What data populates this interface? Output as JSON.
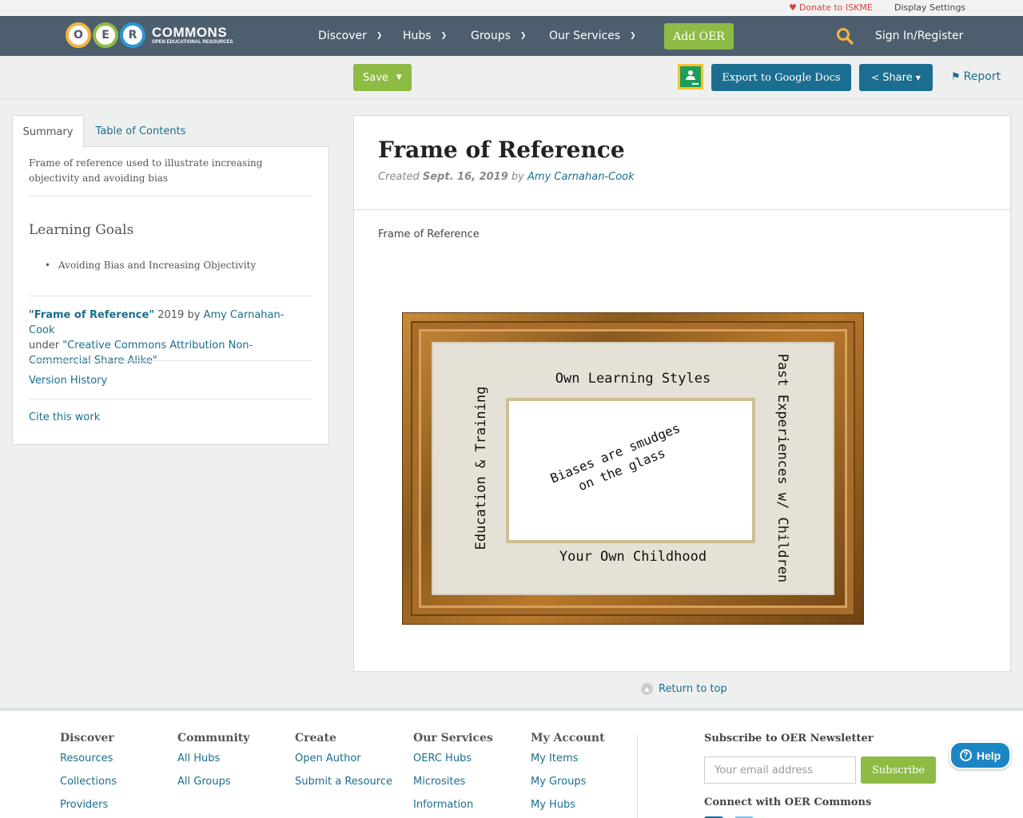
{
  "utility": {
    "donate": "Donate to ISKME",
    "display_settings": "Display Settings"
  },
  "nav": {
    "logo_letters": [
      "O",
      "E",
      "R"
    ],
    "logo_word": "COMMONS",
    "logo_tagline": "OPEN EDUCATIONAL RESOURCES",
    "items": [
      "Discover",
      "Hubs",
      "Groups",
      "Our Services"
    ],
    "add_oer": "Add OER",
    "sign_in": "Sign In/Register"
  },
  "toolbar": {
    "save": "Save",
    "export_google_docs": "Export to Google Docs",
    "share": "Share",
    "report": "Report"
  },
  "sidebar": {
    "tabs": [
      "Summary",
      "Table of Contents"
    ],
    "description": "Frame of reference used to illustrate increasing objectivity and avoiding bias",
    "learning_goals_heading": "Learning Goals",
    "learning_goals": [
      "Avoiding Bias and Increasing Objectivity"
    ],
    "attribution": {
      "title": "\"Frame of Reference\"",
      "year": "2019 by",
      "author": "Amy Carnahan-Cook",
      "under": "under",
      "license": "\"Creative Commons Attribution Non-Commercial Share Alike\""
    },
    "version_history": "Version History",
    "cite": "Cite this work"
  },
  "content": {
    "title": "Frame of Reference",
    "created_label": "Created",
    "date": "Sept. 16, 2019",
    "by": "by",
    "author": "Amy Carnahan-Cook",
    "subtitle": "Frame of Reference",
    "image_labels": {
      "top": "Own Learning Styles",
      "bottom": "Your Own Childhood",
      "left": "Education & Training",
      "right": "Past Experiences w/ Children",
      "center": "Biases are smudges\non the glass"
    }
  },
  "return_to_top": "Return to top",
  "footer": {
    "columns": [
      {
        "heading": "Discover",
        "links": [
          "Resources",
          "Collections",
          "Providers"
        ]
      },
      {
        "heading": "Community",
        "links": [
          "All Hubs",
          "All Groups"
        ]
      },
      {
        "heading": "Create",
        "links": [
          "Open Author",
          "Submit a Resource"
        ]
      },
      {
        "heading": "Our Services",
        "links": [
          "OERC Hubs",
          "Microsites",
          "Information"
        ]
      },
      {
        "heading": "My Account",
        "links": [
          "My Items",
          "My Groups",
          "My Hubs"
        ]
      }
    ],
    "newsletter_heading": "Subscribe to OER Newsletter",
    "email_placeholder": "Your email address",
    "subscribe": "Subscribe",
    "connect_heading": "Connect with OER Commons"
  },
  "help": "Help",
  "colors": {
    "nav_bg": "#4d5e6e",
    "accent_green": "#8dbb44",
    "accent_blue": "#1b6e8f",
    "donate_red": "#d64541"
  },
  "icons": [
    "heart-icon",
    "search-icon",
    "chevron-down-icon",
    "google-classroom-icon",
    "share-icon",
    "flag-icon",
    "arrow-up-icon",
    "question-icon"
  ]
}
